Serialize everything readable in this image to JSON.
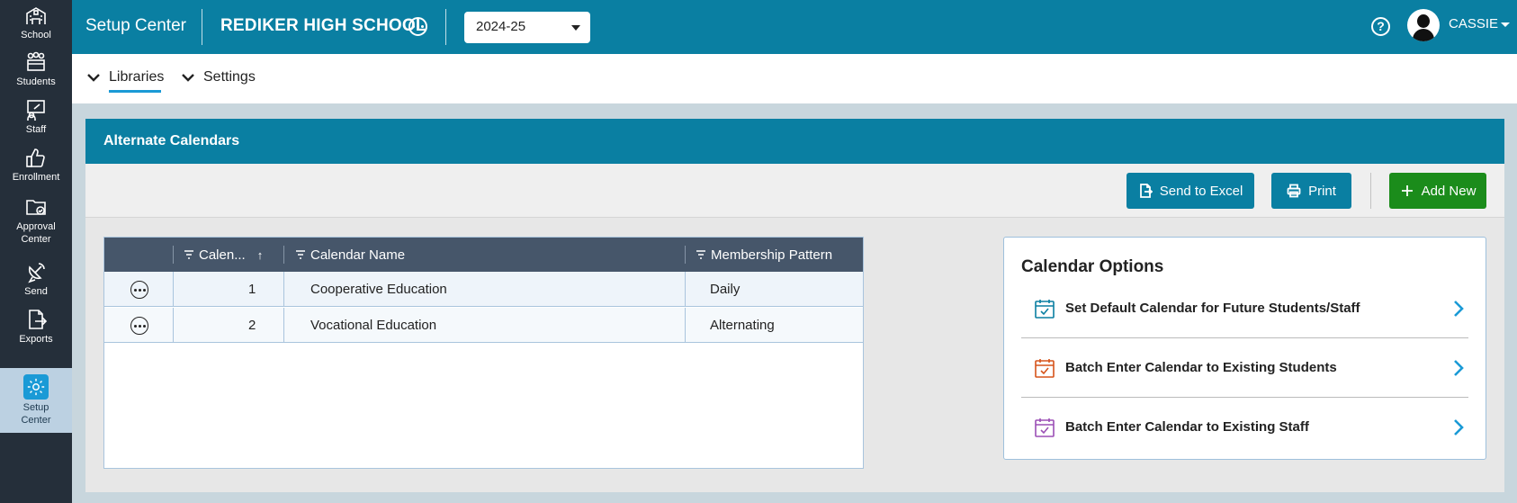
{
  "rail": {
    "items": [
      {
        "label": "School",
        "icon": "school-icon"
      },
      {
        "label": "Students",
        "icon": "students-icon"
      },
      {
        "label": "Staff",
        "icon": "staff-icon"
      },
      {
        "label": "Enrollment",
        "icon": "thumbs-up-icon"
      },
      {
        "label_line1": "Approval",
        "label_line2": "Center",
        "icon": "folder-check-icon"
      },
      {
        "label": "Send",
        "icon": "satellite-icon"
      },
      {
        "label": "Exports",
        "icon": "file-export-icon"
      },
      {
        "label_line1": "Setup",
        "label_line2": "Center",
        "icon": "gear-icon",
        "active": true
      }
    ]
  },
  "topbar": {
    "app_title": "Setup Center",
    "school_name": "REDIKER HIGH SCHOOL",
    "year": "2024-25",
    "help_icon": "?",
    "user_name": "CASSIE"
  },
  "subnav": {
    "items": [
      {
        "label": "Libraries",
        "active": true
      },
      {
        "label": "Settings",
        "active": false
      }
    ]
  },
  "card": {
    "title": "Alternate Calendars",
    "toolbar": {
      "send_to_excel": "Send to Excel",
      "print": "Print",
      "add_new": "Add New"
    }
  },
  "grid": {
    "columns": [
      "Calen...",
      "Calendar Name",
      "Membership Pattern"
    ],
    "sort_indicator": "↑",
    "rows": [
      {
        "number": "1",
        "name": "Cooperative Education",
        "pattern": "Daily"
      },
      {
        "number": "2",
        "name": "Vocational Education",
        "pattern": "Alternating"
      }
    ]
  },
  "calendar_options": {
    "title": "Calendar Options",
    "items": [
      {
        "label": "Set Default Calendar for Future Students/Staff",
        "icon_color": "#0a7fa2"
      },
      {
        "label": "Batch Enter Calendar to Existing Students",
        "icon_color": "#d6531a"
      },
      {
        "label": "Batch Enter Calendar to Existing Staff",
        "icon_color": "#9b4fb5"
      }
    ]
  },
  "colors": {
    "brand": "#0a7fa2",
    "rail": "#252f3a",
    "add_new": "#1b8c1b",
    "grid_header": "#46566a"
  }
}
